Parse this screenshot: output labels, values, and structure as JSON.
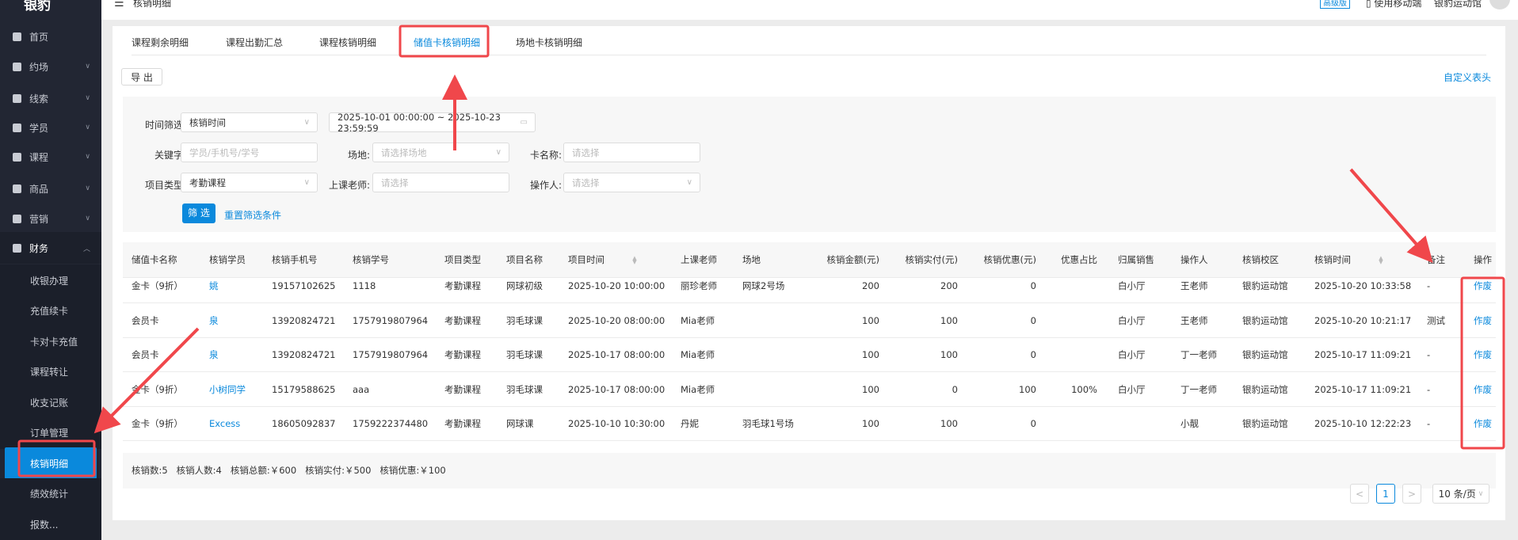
{
  "app": {
    "logo": "银豹"
  },
  "header": {
    "title": "核销明细",
    "badge": "高级版",
    "mobile": "使用移动端",
    "store": "银豹运动馆"
  },
  "sidebar": {
    "items": [
      {
        "label": "首页",
        "icon": "home-icon"
      },
      {
        "label": "约场",
        "icon": "calendar-icon"
      },
      {
        "label": "线索",
        "icon": "user-icon"
      },
      {
        "label": "学员",
        "icon": "id-card-icon"
      },
      {
        "label": "课程",
        "icon": "book-icon"
      },
      {
        "label": "商品",
        "icon": "goods-icon"
      },
      {
        "label": "营销",
        "icon": "gift-icon"
      },
      {
        "label": "财务",
        "icon": "yuan-icon"
      }
    ],
    "finance_sub": [
      "收银办理",
      "充值续卡",
      "卡对卡充值",
      "课程转让",
      "收支记账",
      "订单管理",
      "核销明细",
      "绩效统计",
      "报数..."
    ]
  },
  "tabs": [
    "课程剩余明细",
    "课程出勤汇总",
    "课程核销明细",
    "储值卡核销明细",
    "场地卡核销明细"
  ],
  "toolbar": {
    "export": "导 出",
    "custom_header": "自定义表头"
  },
  "filters": {
    "time_label": "时间筛选:",
    "time_type": "核销时间",
    "date_range": "2025-10-01 00:00:00 ~ 2025-10-23 23:59:59",
    "keyword_label": "关键字:",
    "keyword_ph": "学员/手机号/学号",
    "venue_label": "场地:",
    "venue_ph": "请选择场地",
    "card_label": "卡名称:",
    "card_ph": "请选择",
    "type_label": "项目类型:",
    "type_value": "考勤课程",
    "teacher_label": "上课老师:",
    "teacher_ph": "请选择",
    "operator_label": "操作人:",
    "operator_ph": "请选择",
    "submit": "筛 选",
    "reset": "重置筛选条件"
  },
  "table": {
    "headers": [
      "储值卡名称",
      "核销学员",
      "核销手机号",
      "核销学号",
      "项目类型",
      "项目名称",
      "项目时间",
      "上课老师",
      "场地",
      "核销金额(元)",
      "核销实付(元)",
      "核销优惠(元)",
      "优惠占比",
      "归属销售",
      "操作人",
      "核销校区",
      "核销时间",
      "备注",
      "操作"
    ],
    "rows": [
      [
        "金卡（9折）",
        "姚",
        "19157102625",
        "1118",
        "考勤课程",
        "网球初级",
        "2025-10-20 10:00:00",
        "丽珍老师",
        "网球2号场",
        "200",
        "200",
        "0",
        "",
        "白小厅",
        "王老师",
        "银豹运动馆",
        "2025-10-20 10:33:58",
        "-",
        "作废"
      ],
      [
        "会员卡",
        "泉",
        "13920824721",
        "1757919807964",
        "考勤课程",
        "羽毛球课",
        "2025-10-20 08:00:00",
        "Mia老师",
        "",
        "100",
        "100",
        "0",
        "",
        "白小厅",
        "王老师",
        "银豹运动馆",
        "2025-10-20 10:21:17",
        "测试",
        "作废"
      ],
      [
        "会员卡",
        "泉",
        "13920824721",
        "1757919807964",
        "考勤课程",
        "羽毛球课",
        "2025-10-17 08:00:00",
        "Mia老师",
        "",
        "100",
        "100",
        "0",
        "",
        "白小厅",
        "丁一老师",
        "银豹运动馆",
        "2025-10-17 11:09:21",
        "-",
        "作废"
      ],
      [
        "金卡（9折）",
        "小树同学",
        "15179588625",
        "aaa",
        "考勤课程",
        "羽毛球课",
        "2025-10-17 08:00:00",
        "Mia老师",
        "",
        "100",
        "0",
        "100",
        "100%",
        "白小厅",
        "丁一老师",
        "银豹运动馆",
        "2025-10-17 11:09:21",
        "-",
        "作废"
      ],
      [
        "金卡（9折）",
        "Excess",
        "18605092837",
        "1759222374480",
        "考勤课程",
        "网球课",
        "2025-10-10 10:30:00",
        "丹妮",
        "羽毛球1号场",
        "100",
        "100",
        "0",
        "",
        "",
        "小靓",
        "银豹运动馆",
        "2025-10-10 12:22:23",
        "-",
        "作废"
      ]
    ],
    "summary": "核销数:5   核销人数:4   核销总额:￥600   核销实付:￥500   核销优惠:￥100"
  },
  "pagination": {
    "prev": "<",
    "current": "1",
    "next": ">",
    "page_size": "10 条/页"
  },
  "colors": {
    "accent": "#0a89dc",
    "sidebar": "#222633",
    "annotation": "#f0474b"
  }
}
